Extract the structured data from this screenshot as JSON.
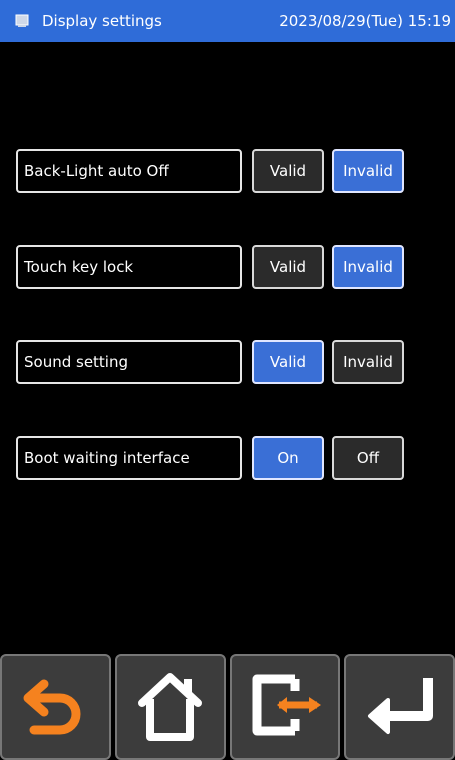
{
  "header": {
    "title": "Display settings",
    "datetime": "2023/08/29(Tue) 15:19",
    "icon": "screen-icon",
    "color": "#2f6cd8"
  },
  "settings": [
    {
      "label": "Back-Light auto Off",
      "options": [
        "Valid",
        "Invalid"
      ],
      "selected": "Invalid"
    },
    {
      "label": "Touch key lock",
      "options": [
        "Valid",
        "Invalid"
      ],
      "selected": "Invalid"
    },
    {
      "label": "Sound setting",
      "options": [
        "Valid",
        "Invalid"
      ],
      "selected": "Valid"
    },
    {
      "label": "Boot waiting interface",
      "options": [
        "On",
        "Off"
      ],
      "selected": "On"
    }
  ],
  "colors": {
    "selected": "#3a6fd6",
    "unselected": "#2b2b2b",
    "accent_orange": "#f5821f"
  },
  "bottom_nav": [
    "back-icon",
    "home-icon",
    "switch-icon",
    "enter-icon"
  ]
}
